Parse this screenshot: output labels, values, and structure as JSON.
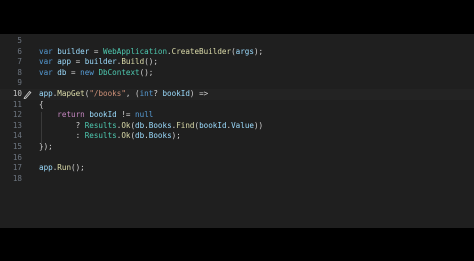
{
  "editor": {
    "lines": [
      {
        "num": "5",
        "tokens": []
      },
      {
        "num": "6",
        "tokens": [
          {
            "t": "var",
            "c": "kw"
          },
          {
            "t": " ",
            "c": "pn"
          },
          {
            "t": "builder",
            "c": "id"
          },
          {
            "t": " = ",
            "c": "pn"
          },
          {
            "t": "WebApplication",
            "c": "ty"
          },
          {
            "t": ".",
            "c": "pn"
          },
          {
            "t": "CreateBuilder",
            "c": "fn"
          },
          {
            "t": "(",
            "c": "pn"
          },
          {
            "t": "args",
            "c": "id"
          },
          {
            "t": ");",
            "c": "pn"
          }
        ]
      },
      {
        "num": "7",
        "tokens": [
          {
            "t": "var",
            "c": "kw"
          },
          {
            "t": " ",
            "c": "pn"
          },
          {
            "t": "app",
            "c": "id"
          },
          {
            "t": " = ",
            "c": "pn"
          },
          {
            "t": "builder",
            "c": "id"
          },
          {
            "t": ".",
            "c": "pn"
          },
          {
            "t": "Build",
            "c": "fn"
          },
          {
            "t": "();",
            "c": "pn"
          }
        ]
      },
      {
        "num": "8",
        "tokens": [
          {
            "t": "var",
            "c": "kw"
          },
          {
            "t": " ",
            "c": "pn"
          },
          {
            "t": "db",
            "c": "id"
          },
          {
            "t": " = ",
            "c": "pn"
          },
          {
            "t": "new",
            "c": "kw"
          },
          {
            "t": " ",
            "c": "pn"
          },
          {
            "t": "DbContext",
            "c": "ty"
          },
          {
            "t": "();",
            "c": "pn"
          }
        ]
      },
      {
        "num": "9",
        "tokens": []
      },
      {
        "num": "10",
        "current": true,
        "tokens": [
          {
            "t": "app",
            "c": "id"
          },
          {
            "t": ".",
            "c": "pn"
          },
          {
            "t": "MapGet",
            "c": "fn"
          },
          {
            "t": "(",
            "c": "pn"
          },
          {
            "t": "\"/books\"",
            "c": "str"
          },
          {
            "t": ", (",
            "c": "pn"
          },
          {
            "t": "int",
            "c": "kw"
          },
          {
            "t": "? ",
            "c": "pn"
          },
          {
            "t": "bookId",
            "c": "id"
          },
          {
            "t": ") =>",
            "c": "pn"
          }
        ]
      },
      {
        "num": "11",
        "tokens": [
          {
            "t": "{",
            "c": "pn"
          }
        ]
      },
      {
        "num": "12",
        "tokens": [
          {
            "t": "    ",
            "c": "pn"
          },
          {
            "t": "return",
            "c": "kw2"
          },
          {
            "t": " ",
            "c": "pn"
          },
          {
            "t": "bookId",
            "c": "id"
          },
          {
            "t": " != ",
            "c": "pn"
          },
          {
            "t": "null",
            "c": "kw"
          }
        ]
      },
      {
        "num": "13",
        "tokens": [
          {
            "t": "        ? ",
            "c": "pn"
          },
          {
            "t": "Results",
            "c": "ty"
          },
          {
            "t": ".",
            "c": "pn"
          },
          {
            "t": "Ok",
            "c": "fn"
          },
          {
            "t": "(",
            "c": "pn"
          },
          {
            "t": "db",
            "c": "id"
          },
          {
            "t": ".",
            "c": "pn"
          },
          {
            "t": "Books",
            "c": "id"
          },
          {
            "t": ".",
            "c": "pn"
          },
          {
            "t": "Find",
            "c": "fn"
          },
          {
            "t": "(",
            "c": "pn"
          },
          {
            "t": "bookId",
            "c": "id"
          },
          {
            "t": ".",
            "c": "pn"
          },
          {
            "t": "Value",
            "c": "id"
          },
          {
            "t": "))",
            "c": "pn"
          }
        ]
      },
      {
        "num": "14",
        "tokens": [
          {
            "t": "        : ",
            "c": "pn"
          },
          {
            "t": "Results",
            "c": "ty"
          },
          {
            "t": ".",
            "c": "pn"
          },
          {
            "t": "Ok",
            "c": "fn"
          },
          {
            "t": "(",
            "c": "pn"
          },
          {
            "t": "db",
            "c": "id"
          },
          {
            "t": ".",
            "c": "pn"
          },
          {
            "t": "Books",
            "c": "id"
          },
          {
            "t": ");",
            "c": "pn"
          }
        ]
      },
      {
        "num": "15",
        "tokens": [
          {
            "t": "});",
            "c": "pn"
          }
        ]
      },
      {
        "num": "16",
        "tokens": []
      },
      {
        "num": "17",
        "tokens": [
          {
            "t": "app",
            "c": "id"
          },
          {
            "t": ".",
            "c": "pn"
          },
          {
            "t": "Run",
            "c": "fn"
          },
          {
            "t": "();",
            "c": "pn"
          }
        ]
      },
      {
        "num": "18",
        "tokens": []
      }
    ],
    "lightbulb_icon": "lightbulb-edit-icon",
    "colors": {
      "background": "#1f1f1f",
      "keyword": "#569cd6",
      "control_keyword": "#c586c0",
      "identifier": "#9cdcfe",
      "function": "#dcdcaa",
      "type": "#4ec9b0",
      "string": "#ce9178"
    }
  }
}
